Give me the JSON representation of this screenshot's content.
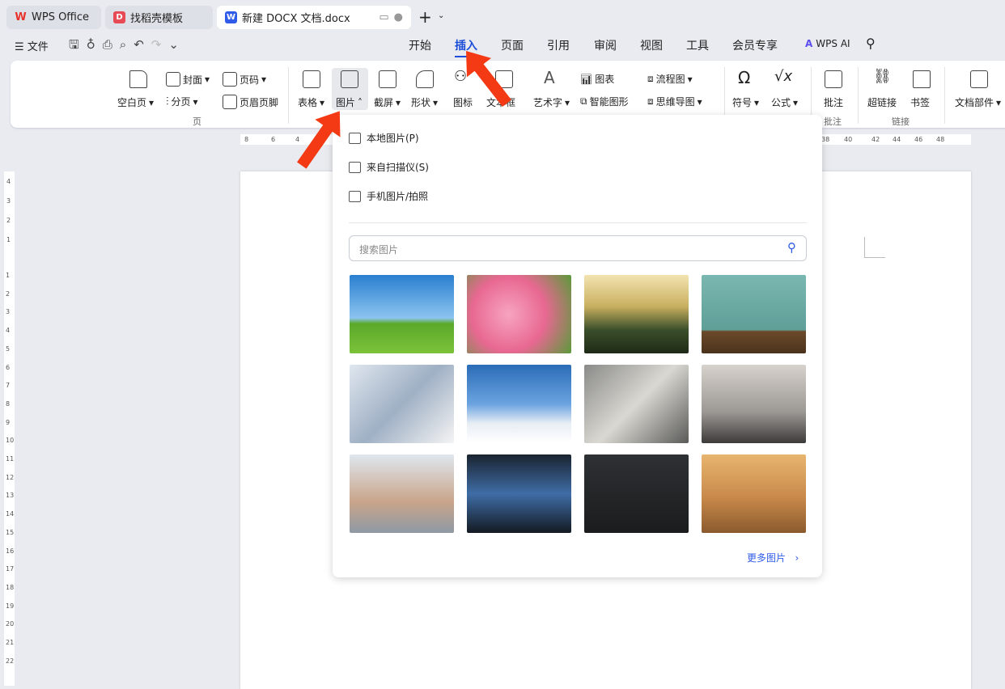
{
  "tabs": [
    {
      "label": "WPS Office",
      "icon": "wps-logo",
      "color": "#e8322b"
    },
    {
      "label": "找稻壳模板",
      "icon": "docer-logo",
      "color": "#e84a55"
    },
    {
      "label": "新建 DOCX 文档.docx",
      "icon": "word-logo",
      "color": "#2f5be8"
    }
  ],
  "quick": {
    "file": "文件"
  },
  "menu": [
    "开始",
    "插入",
    "页面",
    "引用",
    "审阅",
    "视图",
    "工具",
    "会员专享"
  ],
  "active_menu": "插入",
  "wps_ai": "WPS AI",
  "ribbon": {
    "blank_page": "空白页",
    "cover": "封面",
    "page_num": "页码",
    "page_break": "分页",
    "header_footer": "页眉页脚",
    "group_page": "页",
    "table": "表格",
    "picture": "图片",
    "screenshot": "截屏",
    "shape": "形状",
    "icon": "图标",
    "textbox": "文本框",
    "wordart": "艺术字",
    "chart": "图表",
    "smartart": "智能图形",
    "flowchart": "流程图",
    "mindmap": "思维导图",
    "symbol": "符号",
    "formula": "公式",
    "comment": "批注",
    "group_comment": "批注",
    "hyperlink": "超链接",
    "bookmark": "书签",
    "group_link": "链接",
    "doc_parts": "文档部件"
  },
  "ruler": {
    "left": [
      "8",
      "6",
      "4"
    ],
    "right": [
      "38",
      "40",
      "42",
      "44",
      "46",
      "48"
    ],
    "vertical_top": [
      "4",
      "3",
      "2",
      "1"
    ],
    "vertical": [
      "1",
      "2",
      "3",
      "4",
      "5",
      "6",
      "7",
      "8",
      "9",
      "10",
      "11",
      "12",
      "13",
      "14",
      "15",
      "16",
      "17",
      "18",
      "19",
      "20",
      "21",
      "22"
    ]
  },
  "dropdown": {
    "local": "本地图片(P)",
    "scanner": "来自扫描仪(S)",
    "phone": "手机图片/拍照",
    "search_placeholder": "搜索图片",
    "more": "更多图片",
    "images": [
      "tree on grass field",
      "pink tulips",
      "solar panels at sunset",
      "apple on wooden table",
      "hands with phone and tablet",
      "airplane above clouds",
      "signing a document",
      "treadmills in gym",
      "raised fists teamwork",
      "excited man at laptop",
      "man facing chalkboard question marks",
      "horse running on sand"
    ]
  }
}
